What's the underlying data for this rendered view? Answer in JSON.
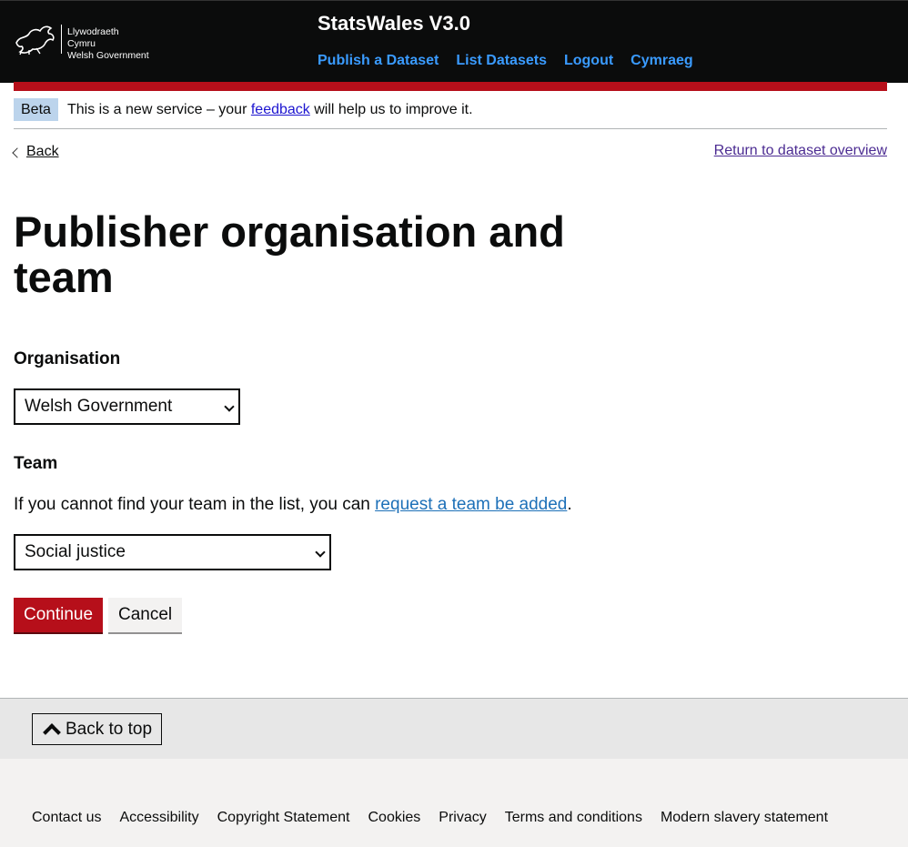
{
  "header": {
    "logo_line1": "Llywodraeth Cymru",
    "logo_line2": "Welsh Government",
    "site_title": "StatsWales V3.0",
    "nav": [
      "Publish a Dataset",
      "List Datasets",
      "Logout",
      "Cymraeg"
    ]
  },
  "beta": {
    "tag": "Beta",
    "text_before": "This is a new service – your ",
    "link": "feedback",
    "text_after": " will help us to improve it."
  },
  "back_link": "Back",
  "return_link": "Return to dataset overview",
  "page_title": "Publisher organisation and team",
  "organisation": {
    "label": "Organisation",
    "selected": "Welsh Government"
  },
  "team": {
    "label": "Team",
    "hint_before": "If you cannot find your team in the list, you can ",
    "hint_link": "request a team be added",
    "hint_after": ".",
    "selected": "Social justice"
  },
  "buttons": {
    "continue": "Continue",
    "cancel": "Cancel"
  },
  "footer": {
    "back_to_top": "Back to top",
    "links": [
      "Contact us",
      "Accessibility",
      "Copyright Statement",
      "Cookies",
      "Privacy",
      "Terms and conditions",
      "Modern slavery statement"
    ]
  },
  "colors": {
    "brand_red": "#b60f1a",
    "nav_link": "#3a9bff",
    "link": "#1d70b8"
  }
}
